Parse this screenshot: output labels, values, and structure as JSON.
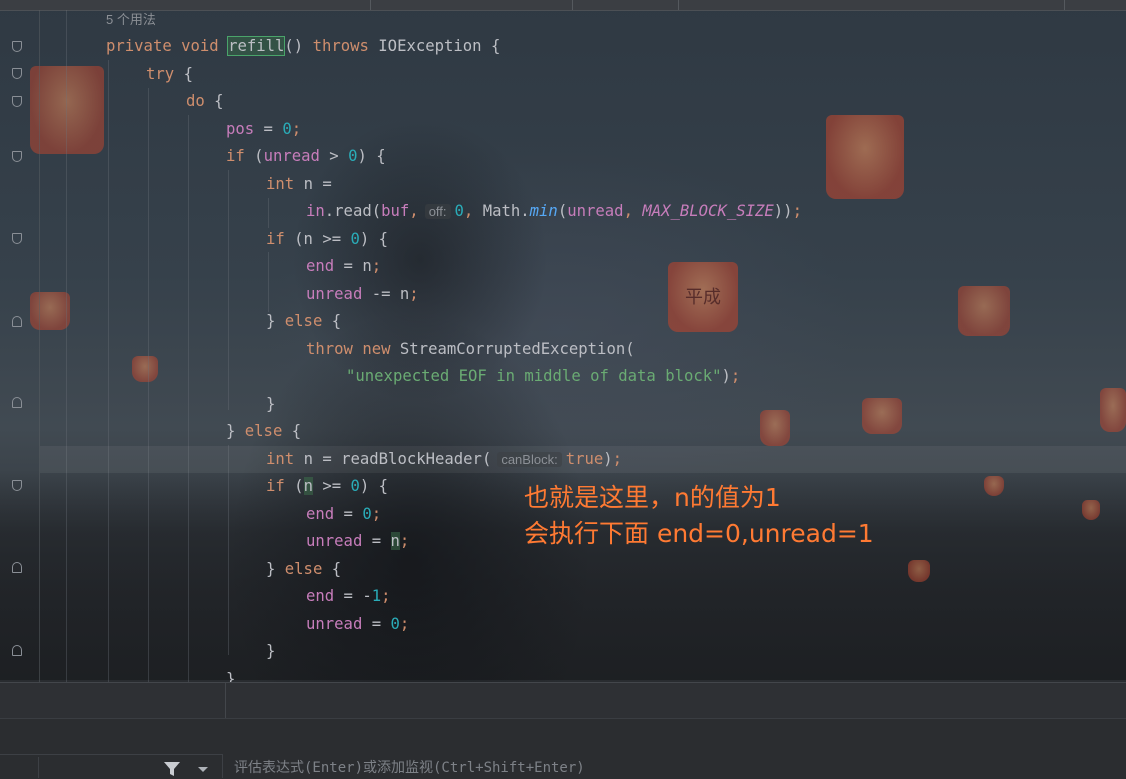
{
  "editor": {
    "usage_hint": "5 个用法",
    "lines": [
      {
        "tokens": [
          [
            "kw",
            "private "
          ],
          [
            "kw",
            "void "
          ],
          [
            "refill",
            "refill"
          ],
          [
            "ty",
            "() "
          ],
          [
            "kw",
            "throws "
          ],
          [
            "ty",
            "IOException {"
          ]
        ]
      },
      {
        "tokens": [
          [
            "kw",
            "try "
          ],
          [
            "ty",
            "{"
          ]
        ]
      },
      {
        "tokens": [
          [
            "kw",
            "do "
          ],
          [
            "ty",
            "{"
          ]
        ]
      },
      {
        "tokens": [
          [
            "fld",
            "pos"
          ],
          [
            "ty",
            " = "
          ],
          [
            "num",
            "0"
          ],
          [
            "kw",
            ";"
          ]
        ]
      },
      {
        "tokens": [
          [
            "kw",
            "if "
          ],
          [
            "ty",
            "("
          ],
          [
            "fld",
            "unread"
          ],
          [
            "ty",
            " > "
          ],
          [
            "num",
            "0"
          ],
          [
            "ty",
            ") {"
          ]
        ]
      },
      {
        "tokens": [
          [
            "kw",
            "int "
          ],
          [
            "ty",
            "n ="
          ]
        ]
      },
      {
        "tokens": [
          [
            "fld",
            "in"
          ],
          [
            "ty",
            ".read("
          ],
          [
            "fld",
            "buf"
          ],
          [
            "kw",
            ","
          ],
          [
            "inlay",
            "off:"
          ],
          [
            "num",
            "0"
          ],
          [
            "kw",
            ", "
          ],
          [
            "ty",
            "Math."
          ],
          [
            "ital",
            "min"
          ],
          [
            "ty",
            "("
          ],
          [
            "fld",
            "unread"
          ],
          [
            "kw",
            ", "
          ],
          [
            "sfld",
            "MAX_BLOCK_SIZE"
          ],
          [
            "ty",
            "))"
          ],
          [
            "kw",
            ";"
          ]
        ]
      },
      {
        "tokens": [
          [
            "kw",
            "if "
          ],
          [
            "ty",
            "(n >= "
          ],
          [
            "num",
            "0"
          ],
          [
            "ty",
            ") {"
          ]
        ]
      },
      {
        "tokens": [
          [
            "fld",
            "end"
          ],
          [
            "ty",
            " = n"
          ],
          [
            "kw",
            ";"
          ]
        ]
      },
      {
        "tokens": [
          [
            "fld",
            "unread"
          ],
          [
            "ty",
            " -= n"
          ],
          [
            "kw",
            ";"
          ]
        ]
      },
      {
        "tokens": [
          [
            "ty",
            "} "
          ],
          [
            "kw",
            "else "
          ],
          [
            "ty",
            "{"
          ]
        ]
      },
      {
        "tokens": [
          [
            "kw",
            "throw "
          ],
          [
            "kw",
            "new "
          ],
          [
            "ty",
            "StreamCorruptedException("
          ]
        ]
      },
      {
        "tokens": [
          [
            "str",
            "\"unexpected EOF in middle of data block\""
          ],
          [
            "ty",
            ")"
          ],
          [
            "kw",
            ";"
          ]
        ]
      },
      {
        "tokens": [
          [
            "ty",
            "}"
          ]
        ]
      },
      {
        "tokens": [
          [
            "ty",
            "} "
          ],
          [
            "kw",
            "else "
          ],
          [
            "ty",
            "{"
          ]
        ]
      },
      {
        "tokens": [
          [
            "kw",
            "int "
          ],
          [
            "ty",
            "n = readBlockHeader("
          ],
          [
            "inlay",
            "canBlock:"
          ],
          [
            "kw",
            "true"
          ],
          [
            "ty",
            ")"
          ],
          [
            "kw",
            ";"
          ]
        ]
      },
      {
        "tokens": [
          [
            "kw",
            "if "
          ],
          [
            "ty",
            "("
          ],
          [
            "var",
            "n"
          ],
          [
            "ty",
            " >= "
          ],
          [
            "num",
            "0"
          ],
          [
            "ty",
            ") {"
          ]
        ]
      },
      {
        "tokens": [
          [
            "fld",
            "end"
          ],
          [
            "ty",
            " = "
          ],
          [
            "num",
            "0"
          ],
          [
            "kw",
            ";"
          ]
        ]
      },
      {
        "tokens": [
          [
            "fld",
            "unread"
          ],
          [
            "ty",
            " = "
          ],
          [
            "var",
            "n"
          ],
          [
            "kw",
            ";"
          ]
        ]
      },
      {
        "tokens": [
          [
            "ty",
            "} "
          ],
          [
            "kw",
            "else "
          ],
          [
            "ty",
            "{"
          ]
        ]
      },
      {
        "tokens": [
          [
            "fld",
            "end"
          ],
          [
            "ty",
            " = -"
          ],
          [
            "num",
            "1"
          ],
          [
            "kw",
            ";"
          ]
        ]
      },
      {
        "tokens": [
          [
            "fld",
            "unread"
          ],
          [
            "ty",
            " = "
          ],
          [
            "num",
            "0"
          ],
          [
            "kw",
            ";"
          ]
        ]
      },
      {
        "tokens": [
          [
            "ty",
            "}"
          ]
        ]
      },
      {
        "tokens": [
          [
            "ty",
            "}"
          ]
        ]
      }
    ]
  },
  "annotation": {
    "line1": "也就是这里，n的值为1",
    "line2": "会执行下面 end=0,unread=1",
    "color": "#ff7a33"
  },
  "background_lanterns": [
    {
      "text": "平成"
    }
  ],
  "debug_panel": {
    "filter_icon": "filter-icon",
    "dropdown_icon": "chevron-down-icon",
    "eval_placeholder": "评估表达式(Enter)或添加监视(Ctrl+Shift+Enter)"
  },
  "colors": {
    "keyword": "#cf8e6d",
    "number": "#2aacb8",
    "string": "#6aab73",
    "field": "#c77dbb",
    "text": "#bcbec4"
  }
}
